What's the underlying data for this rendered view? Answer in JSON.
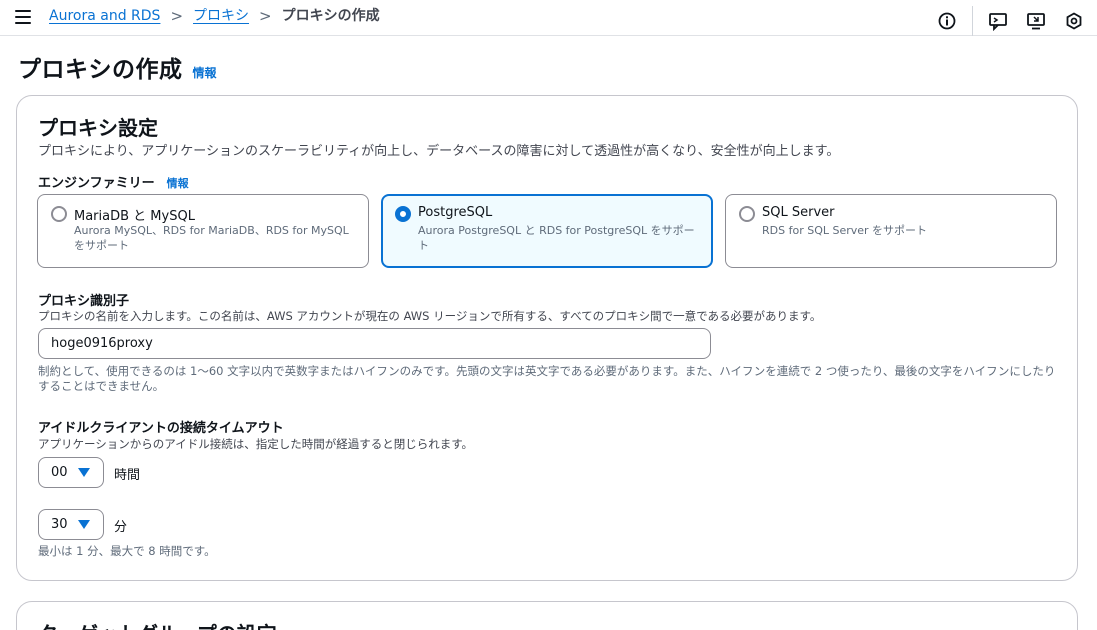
{
  "breadcrumb": {
    "items": [
      "Aurora and RDS",
      "プロキシ"
    ],
    "current": "プロキシの作成"
  },
  "page": {
    "title": "プロキシの作成",
    "info_link": "情報"
  },
  "proxy_settings": {
    "title": "プロキシ設定",
    "description": "プロキシにより、アプリケーションのスケーラビリティが向上し、データベースの障害に対して透過性が高くなり、安全性が向上します。",
    "engine_family": {
      "label": "エンジンファミリー",
      "info_link": "情報",
      "selected": "PostgreSQL",
      "options": [
        {
          "name": "MariaDB と MySQL",
          "description": "Aurora MySQL、RDS for MariaDB、RDS for MySQL をサポート"
        },
        {
          "name": "PostgreSQL",
          "description": "Aurora PostgreSQL と RDS for PostgreSQL をサポート"
        },
        {
          "name": "SQL Server",
          "description": "RDS for SQL Server をサポート"
        }
      ]
    },
    "identifier": {
      "label": "プロキシ識別子",
      "description": "プロキシの名前を入力します。この名前は、AWS アカウントが現在の AWS リージョンで所有する、すべてのプロキシ間で一意である必要があります。",
      "value": "hoge0916proxy",
      "constraint": "制約として、使用できるのは 1〜60 文字以内で英数字またはハイフンのみです。先頭の文字は英文字である必要があります。また、ハイフンを連続で 2 つ使ったり、最後の文字をハイフンにしたりすることはできません。"
    },
    "idle_timeout": {
      "label": "アイドルクライアントの接続タイムアウト",
      "description": "アプリケーションからのアイドル接続は、指定した時間が経過すると閉じられます。",
      "hours_value": "00",
      "hours_unit": "時間",
      "minutes_value": "30",
      "minutes_unit": "分",
      "constraint": "最小は 1 分、最大で 8 時間です。"
    }
  },
  "target_group": {
    "title": "ターゲットグループの設定"
  },
  "colors": {
    "accent": "#0972d3",
    "selected_bg": "#f0fbff",
    "border": "#8c8c94"
  },
  "icons": [
    "menu-icon",
    "chevron-right-icon",
    "info-circle-icon",
    "feedback-icon",
    "screen-icon",
    "settings-hex-icon"
  ]
}
